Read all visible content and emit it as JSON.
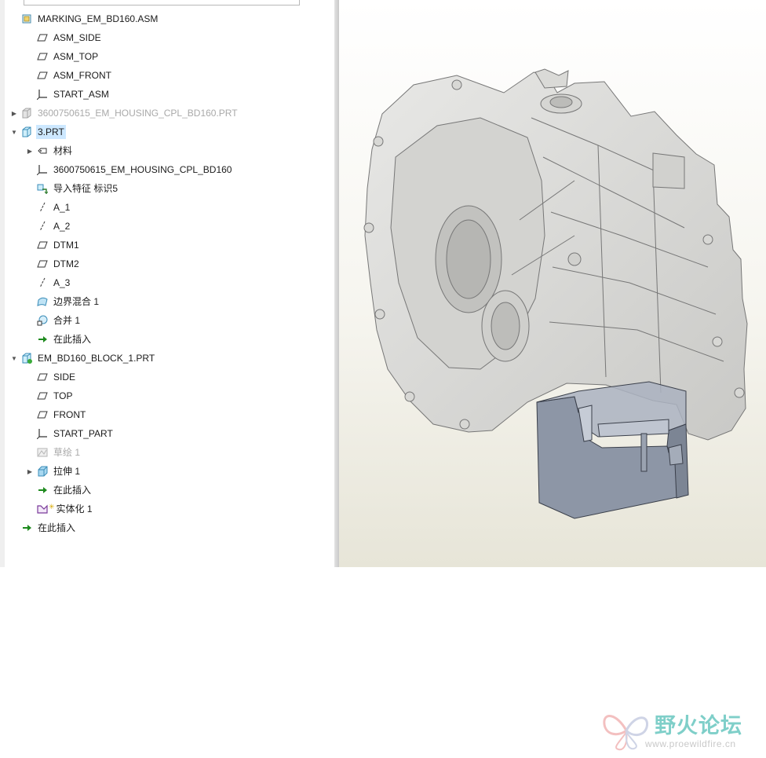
{
  "tree": {
    "items": [
      {
        "id": "root",
        "label": "MARKING_EM_BD160.ASM",
        "icon": "assembly-icon",
        "expander": "none",
        "state": "normal"
      },
      {
        "id": "asm-side",
        "label": "ASM_SIDE",
        "icon": "datum-plane-icon",
        "expander": "none",
        "state": "normal"
      },
      {
        "id": "asm-top",
        "label": "ASM_TOP",
        "icon": "datum-plane-icon",
        "expander": "none",
        "state": "normal"
      },
      {
        "id": "asm-front",
        "label": "ASM_FRONT",
        "icon": "datum-plane-icon",
        "expander": "none",
        "state": "normal"
      },
      {
        "id": "start-asm",
        "label": "START_ASM",
        "icon": "coordinate-system-icon",
        "expander": "none",
        "state": "normal"
      },
      {
        "id": "housing-prt",
        "label": "3600750615_EM_HOUSING_CPL_BD160.PRT",
        "icon": "part-dim-icon",
        "expander": "collapsed",
        "state": "dim"
      },
      {
        "id": "3-prt",
        "label": "3.PRT",
        "icon": "part-icon",
        "expander": "expanded",
        "state": "selected"
      },
      {
        "id": "material",
        "label": "材料",
        "icon": "material-icon",
        "expander": "collapsed",
        "state": "normal"
      },
      {
        "id": "housing-csys",
        "label": "3600750615_EM_HOUSING_CPL_BD160",
        "icon": "coordinate-system-icon",
        "expander": "none",
        "state": "normal"
      },
      {
        "id": "import-feature",
        "label": "导入特征 标识5",
        "icon": "import-feature-icon",
        "expander": "none",
        "state": "normal"
      },
      {
        "id": "a1",
        "label": "A_1",
        "icon": "datum-axis-icon",
        "expander": "none",
        "state": "normal"
      },
      {
        "id": "a2",
        "label": "A_2",
        "icon": "datum-axis-icon",
        "expander": "none",
        "state": "normal"
      },
      {
        "id": "dtm1",
        "label": "DTM1",
        "icon": "datum-plane-icon",
        "expander": "none",
        "state": "normal"
      },
      {
        "id": "dtm2",
        "label": "DTM2",
        "icon": "datum-plane-icon",
        "expander": "none",
        "state": "normal"
      },
      {
        "id": "a3",
        "label": "A_3",
        "icon": "datum-axis-icon",
        "expander": "none",
        "state": "normal"
      },
      {
        "id": "boundary-blend",
        "label": "边界混合 1",
        "icon": "boundary-blend-icon",
        "expander": "none",
        "state": "normal"
      },
      {
        "id": "merge",
        "label": "合并 1",
        "icon": "merge-icon",
        "expander": "none",
        "state": "normal"
      },
      {
        "id": "insert-here-1",
        "label": "在此插入",
        "icon": "insert-arrow-icon",
        "expander": "none",
        "state": "normal"
      },
      {
        "id": "block-prt",
        "label": "EM_BD160_BLOCK_1.PRT",
        "icon": "part-active-icon",
        "expander": "expanded",
        "state": "normal"
      },
      {
        "id": "side",
        "label": "SIDE",
        "icon": "datum-plane-icon",
        "expander": "none",
        "state": "normal"
      },
      {
        "id": "top",
        "label": "TOP",
        "icon": "datum-plane-icon",
        "expander": "none",
        "state": "normal"
      },
      {
        "id": "front",
        "label": "FRONT",
        "icon": "datum-plane-icon",
        "expander": "none",
        "state": "normal"
      },
      {
        "id": "start-part",
        "label": "START_PART",
        "icon": "coordinate-system-icon",
        "expander": "none",
        "state": "normal"
      },
      {
        "id": "sketch",
        "label": "草绘 1",
        "icon": "sketch-icon",
        "expander": "none",
        "state": "dim"
      },
      {
        "id": "extrude",
        "label": "拉伸 1",
        "icon": "extrude-icon",
        "expander": "collapsed",
        "state": "normal"
      },
      {
        "id": "insert-here-2",
        "label": "在此插入",
        "icon": "insert-arrow-icon",
        "expander": "none",
        "state": "normal"
      },
      {
        "id": "solidify",
        "label": "实体化 1",
        "icon": "solidify-icon",
        "expander": "none",
        "state": "normal"
      },
      {
        "id": "insert-here-3",
        "label": "在此插入",
        "icon": "insert-arrow-icon",
        "expander": "none",
        "state": "normal"
      }
    ]
  },
  "colors": {
    "selection": "#cde8ff",
    "insert_arrow": "#1e8a1e",
    "model_housing": "#dcdcda",
    "model_block": "#8e97a6",
    "watermark": "#7fcfc9"
  },
  "watermark": {
    "title": "野火论坛",
    "url": "www.proewildfire.cn"
  }
}
